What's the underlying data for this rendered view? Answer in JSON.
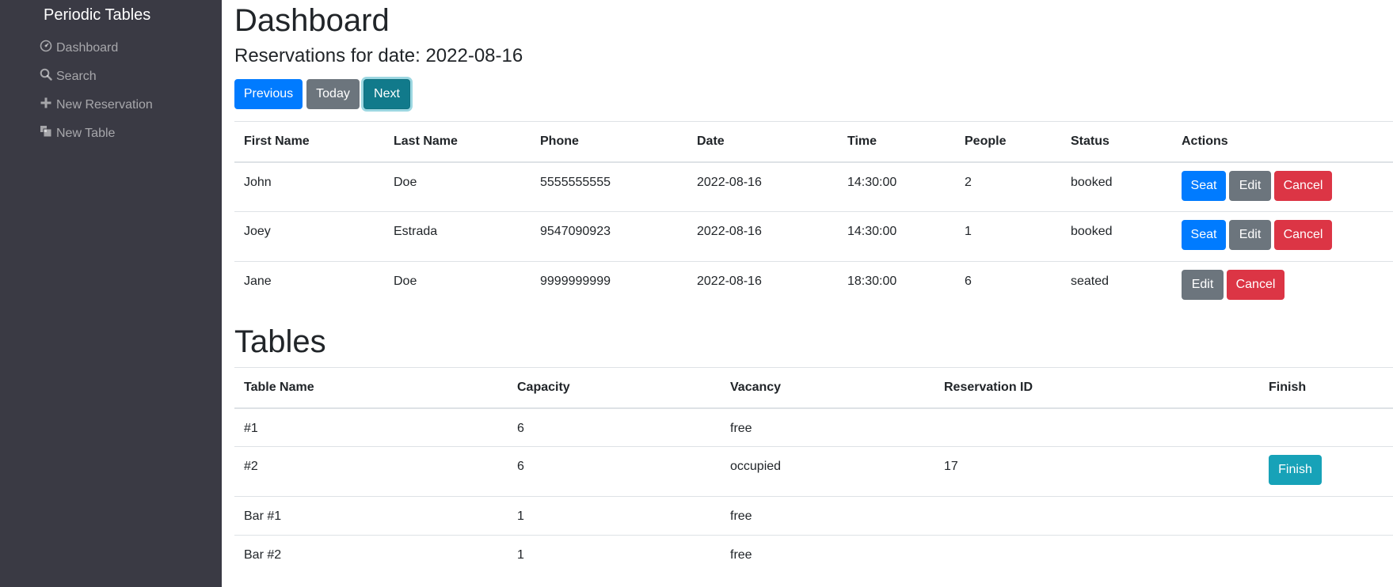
{
  "sidebar": {
    "brand": "Periodic Tables",
    "items": [
      {
        "label": "Dashboard",
        "icon": "dashboard-icon"
      },
      {
        "label": "Search",
        "icon": "search-icon"
      },
      {
        "label": "New Reservation",
        "icon": "plus-icon"
      },
      {
        "label": "New Table",
        "icon": "layers-icon"
      }
    ]
  },
  "main": {
    "title": "Dashboard",
    "subtitle": "Reservations for date: 2022-08-16",
    "nav": {
      "previous": "Previous",
      "today": "Today",
      "next": "Next"
    }
  },
  "reservations": {
    "headers": [
      "First Name",
      "Last Name",
      "Phone",
      "Date",
      "Time",
      "People",
      "Status",
      "Actions"
    ],
    "rows": [
      {
        "first": "John",
        "last": "Doe",
        "phone": "5555555555",
        "date": "2022-08-16",
        "time": "14:30:00",
        "people": "2",
        "status": "booked",
        "seat": "Seat",
        "edit": "Edit",
        "cancel": "Cancel"
      },
      {
        "first": "Joey",
        "last": "Estrada",
        "phone": "9547090923",
        "date": "2022-08-16",
        "time": "14:30:00",
        "people": "1",
        "status": "booked",
        "seat": "Seat",
        "edit": "Edit",
        "cancel": "Cancel"
      },
      {
        "first": "Jane",
        "last": "Doe",
        "phone": "9999999999",
        "date": "2022-08-16",
        "time": "18:30:00",
        "people": "6",
        "status": "seated",
        "edit": "Edit",
        "cancel": "Cancel"
      }
    ]
  },
  "tables": {
    "title": "Tables",
    "headers": [
      "Table Name",
      "Capacity",
      "Vacancy",
      "Reservation ID",
      "Finish"
    ],
    "rows": [
      {
        "name": "#1",
        "capacity": "6",
        "vacancy": "free",
        "reservation_id": ""
      },
      {
        "name": "#2",
        "capacity": "6",
        "vacancy": "occupied",
        "reservation_id": "17",
        "finish": "Finish"
      },
      {
        "name": "Bar #1",
        "capacity": "1",
        "vacancy": "free",
        "reservation_id": ""
      },
      {
        "name": "Bar #2",
        "capacity": "1",
        "vacancy": "free",
        "reservation_id": ""
      }
    ]
  },
  "colors": {
    "sidebar_bg": "#3a3a44",
    "primary": "#007bff",
    "secondary": "#6c757d",
    "danger": "#dc3545",
    "info": "#17a2b8"
  }
}
